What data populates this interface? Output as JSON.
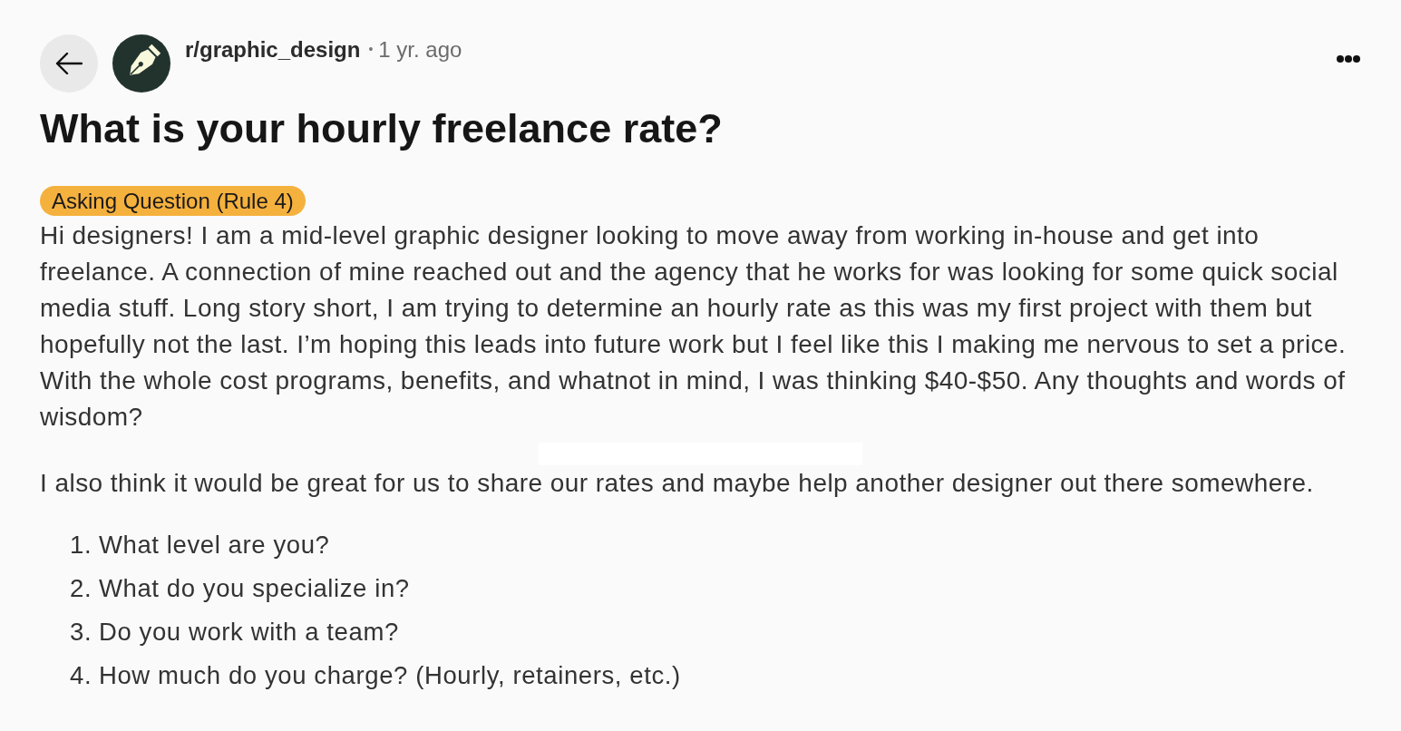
{
  "header": {
    "community": "r/graphic_design",
    "separator": "•",
    "time": "1 yr. ago"
  },
  "post": {
    "title": "What is your hourly freelance rate?",
    "flair": "Asking Question (Rule 4)",
    "paragraphs": [
      "Hi designers! I am a mid-level graphic designer looking to move away from working in-house and get into freelance. A connection of mine reached out and the agency that he works for was looking for some quick social media stuff. Long story short, I am trying to determine an hourly rate as this was my first project with them but hopefully not the last. I’m hoping this leads into future work but I feel like this I making me nervous to set a price. With the whole cost programs, benefits, and whatnot in mind, I was thinking $40-$50. Any thoughts and words of wisdom?",
      "I also think it would be great for us to share our rates and maybe help another designer out there somewhere."
    ],
    "list": [
      {
        "marker": "1.",
        "text": "What level are you?"
      },
      {
        "marker": "2.",
        "text": "What do you specialize in?"
      },
      {
        "marker": "3.",
        "text": "Do you work with a team?"
      },
      {
        "marker": "4.",
        "text": "How much do you charge? (Hourly, retainers, etc.)"
      }
    ]
  }
}
